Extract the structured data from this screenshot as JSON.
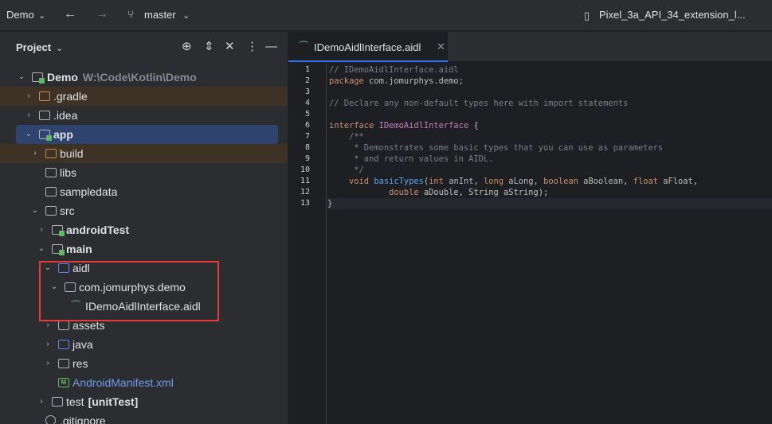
{
  "titlebar": {
    "project": "Demo",
    "branch": "master",
    "device": "Pixel_3a_API_34_extension_l..."
  },
  "project_panel": {
    "title": "Project"
  },
  "tree": [
    {
      "label": "Demo",
      "sub": "W:\\Code\\Kotlin\\Demo"
    },
    {
      "label": ".gradle"
    },
    {
      "label": ".idea"
    },
    {
      "label": "app"
    },
    {
      "label": "build"
    },
    {
      "label": "libs"
    },
    {
      "label": "sampledata"
    },
    {
      "label": "src"
    },
    {
      "label": "androidTest"
    },
    {
      "label": "main"
    },
    {
      "label": "aidl"
    },
    {
      "label": "com.jomurphys.demo"
    },
    {
      "label": "IDemoAidlInterface.aidl"
    },
    {
      "label": "assets"
    },
    {
      "label": "java"
    },
    {
      "label": "res"
    },
    {
      "label": "AndroidManifest.xml"
    },
    {
      "label": "test",
      "sub": "[unitTest]"
    },
    {
      "label": ".gitignore"
    }
  ],
  "editor": {
    "tab_label": "IDemoAidlInterface.aidl",
    "line_numbers": [
      "1",
      "2",
      "3",
      "4",
      "5",
      "6",
      "7",
      "8",
      "9",
      "10",
      "11",
      "12",
      "13"
    ],
    "code": [
      "// IDemoAidlInterface.aidl",
      "package com.jomurphys.demo;",
      "",
      "// Declare any non-default types here with import statements",
      "",
      "interface IDemoAidlInterface {",
      "    /**",
      "     * Demonstrates some basic types that you can use as parameters",
      "     * and return values in AIDL.",
      "     */",
      "    void basicTypes(int anInt, long aLong, boolean aBoolean, float aFloat,",
      "            double aDouble, String aString);",
      "}"
    ]
  },
  "colors": {
    "selection": "#2e436e",
    "excluded_bg": "#3d3223",
    "highlight_box": "#e5393b",
    "keyword": "#cf8e6d",
    "comment": "#7a7e85"
  },
  "icons": [
    "chevron-down-icon",
    "arrow-left-icon",
    "arrow-right-icon",
    "branch-icon",
    "device-icon",
    "locate-icon",
    "expand-icon",
    "collapse-icon",
    "more-icon",
    "minimize-icon",
    "folder-icon",
    "module-icon",
    "android-file-icon",
    "manifest-icon",
    "close-icon"
  ]
}
